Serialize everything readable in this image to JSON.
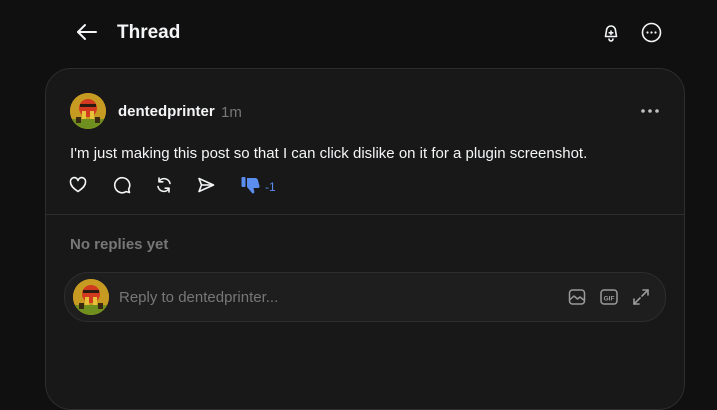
{
  "header": {
    "title": "Thread",
    "icons": [
      "back-arrow-icon",
      "bell-plus-icon",
      "more-circle-icon"
    ]
  },
  "post": {
    "username": "dentedprinter",
    "timestamp": "1m",
    "text": "I'm just making this post so that I can click dislike on it for a plugin screenshot.",
    "dislike_count": "-1",
    "actions": [
      "heart-icon",
      "comment-icon",
      "repost-icon",
      "share-icon",
      "thumbs-down-icon"
    ]
  },
  "replies": {
    "empty_label": "No replies yet"
  },
  "reply_bar": {
    "placeholder": "Reply to dentedprinter...",
    "icons": [
      "image-icon",
      "gif-icon",
      "expand-icon"
    ]
  },
  "colors": {
    "background": "#101010",
    "card": "#181818",
    "border": "#2d2d2d",
    "text": "#f3f5f7",
    "muted": "#777777",
    "dislike_accent": "#5b8def"
  }
}
